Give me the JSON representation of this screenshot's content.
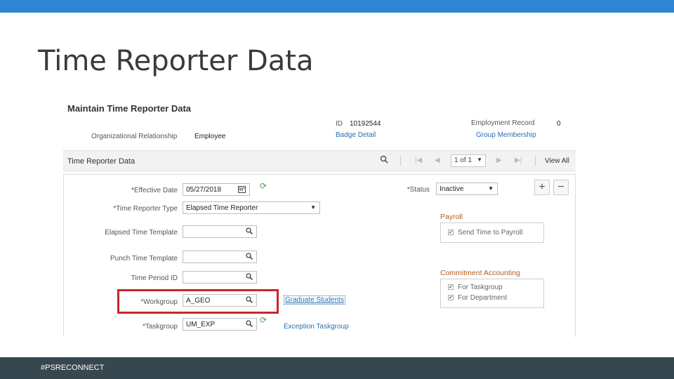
{
  "slide": {
    "title": "Time Reporter Data",
    "footer_tag": "#PSRECONNECT",
    "accent_color": "#2e86d1",
    "footer_color": "#37474f",
    "highlight_color": "#c62828"
  },
  "page": {
    "heading": "Maintain Time Reporter Data",
    "org_relationship_label": "Organizational Relationship",
    "org_relationship_value": "Employee",
    "id_label": "ID",
    "id_value": "10192544",
    "badge_detail_link": "Badge Detail",
    "employment_record_label": "Employment Record",
    "employment_record_value": "0",
    "group_membership_link": "Group Membership"
  },
  "section_bar": {
    "title": "Time Reporter Data",
    "search_icon": "search-icon",
    "paging_value": "1 of 1",
    "view_all": "View All"
  },
  "form": {
    "effective_date_label": "*Effective Date",
    "effective_date_value": "05/27/2018",
    "time_reporter_type_label": "*Time Reporter Type",
    "time_reporter_type_value": "Elapsed Time Reporter",
    "elapsed_template_label": "Elapsed Time Template",
    "elapsed_template_value": "",
    "punch_template_label": "Punch Time Template",
    "punch_template_value": "",
    "time_period_label": "Time Period ID",
    "time_period_value": "",
    "workgroup_label": "*Workgroup",
    "workgroup_value": "A_GEO",
    "workgroup_link": "Graduate Students",
    "taskgroup_label": "*Taskgroup",
    "taskgroup_value": "UM_EXP",
    "taskgroup_link": "Exception Taskgroup",
    "status_label": "*Status",
    "status_value": "Inactive",
    "add_row_label": "+",
    "delete_row_label": "−"
  },
  "payroll": {
    "title": "Payroll",
    "send_time_label": "Send Time to Payroll",
    "send_time_checked": true
  },
  "commitment": {
    "title": "Commitment Accounting",
    "for_taskgroup_label": "For Taskgroup",
    "for_taskgroup_checked": true,
    "for_department_label": "For Department",
    "for_department_checked": true
  }
}
